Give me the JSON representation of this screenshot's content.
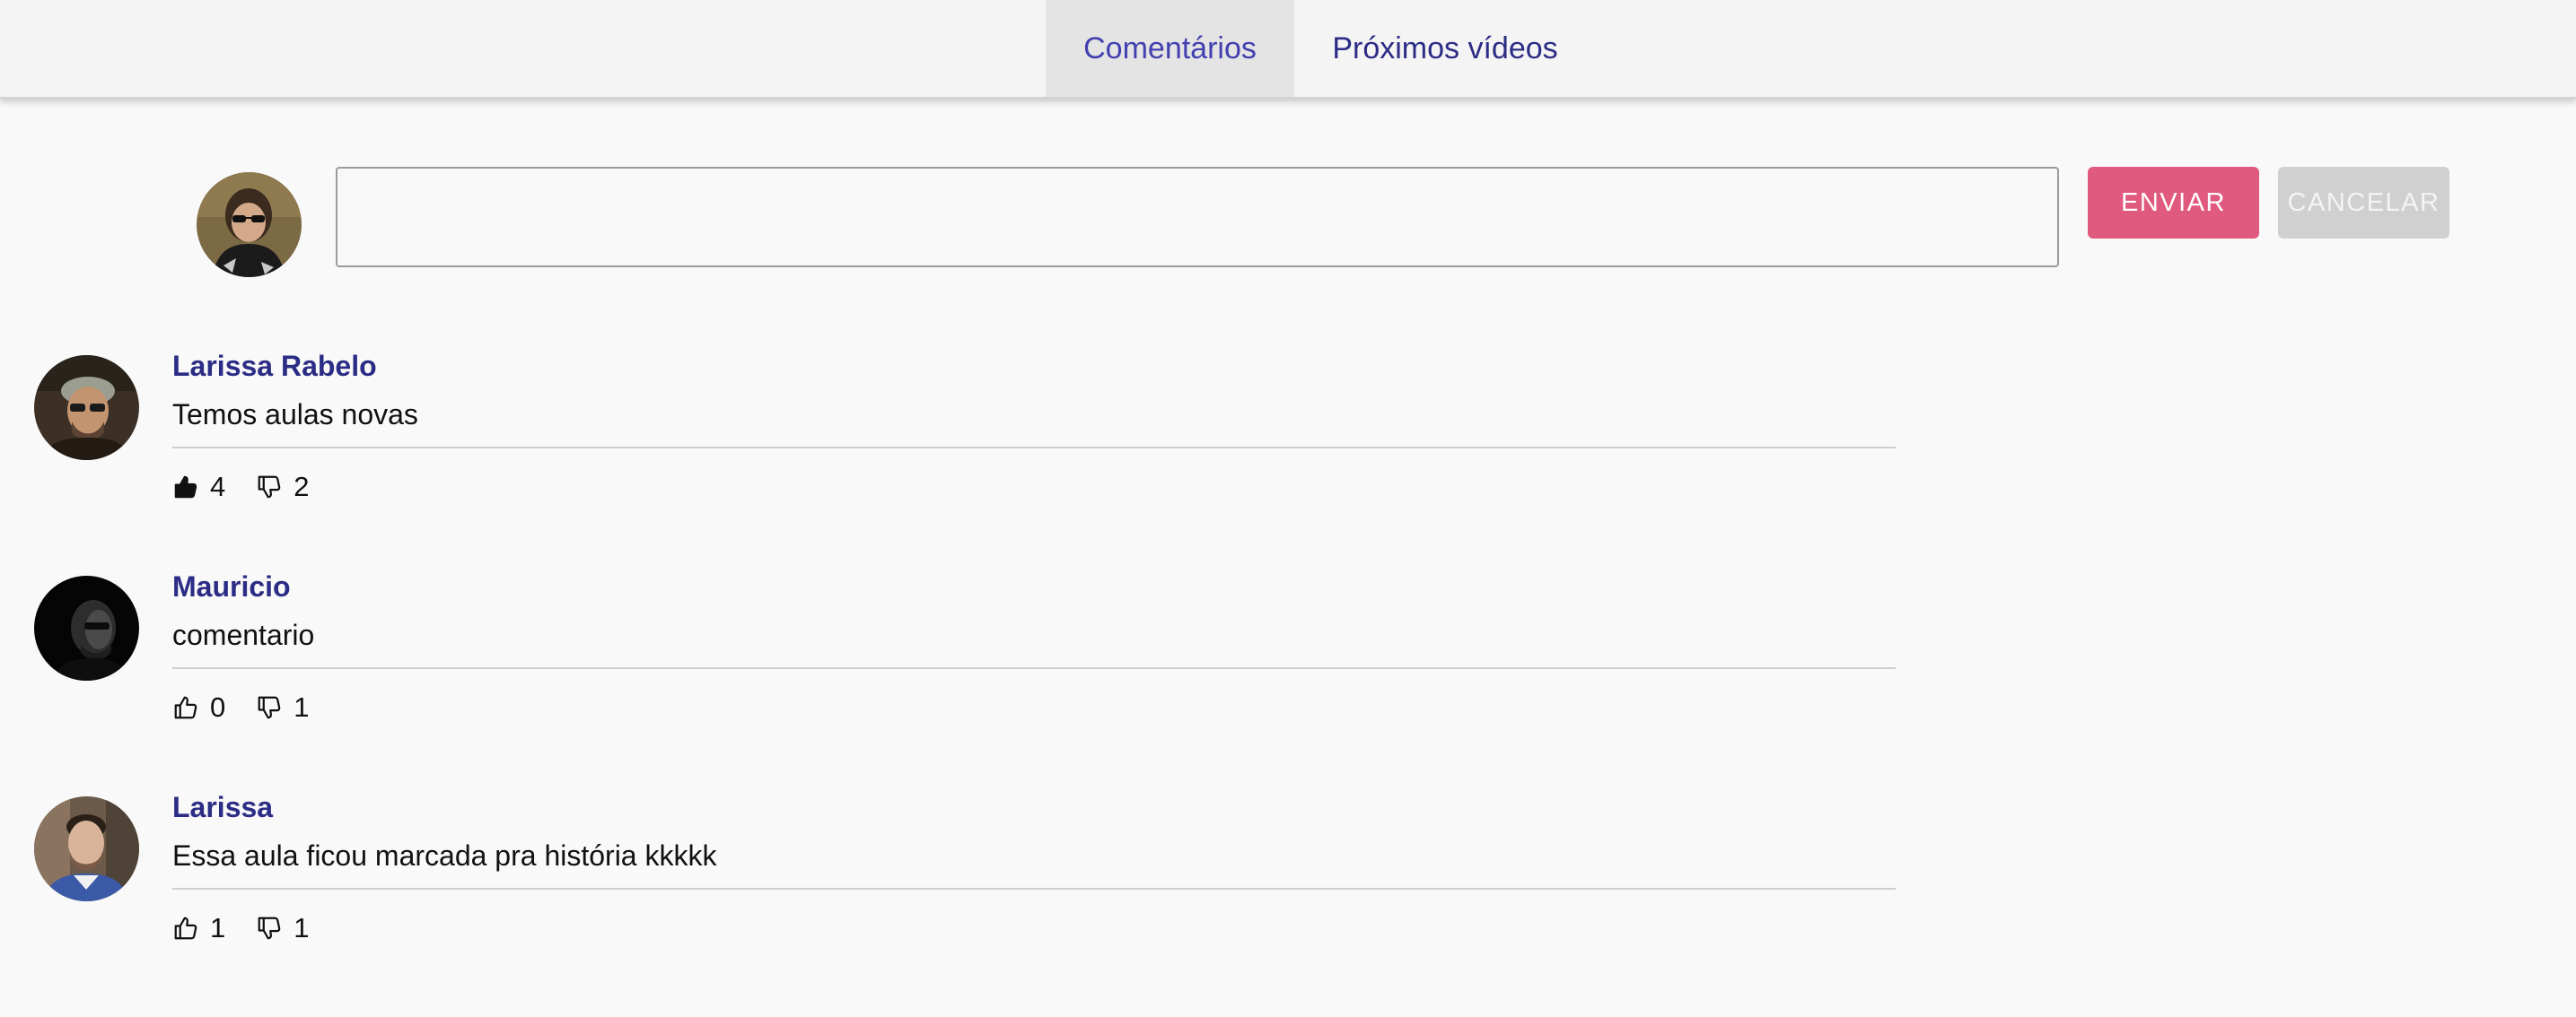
{
  "tabs": [
    {
      "label": "Comentários",
      "active": true
    },
    {
      "label": "Próximos vídeos",
      "active": false
    }
  ],
  "composer": {
    "value": "",
    "send_label": "ENVIAR",
    "cancel_label": "CANCELAR"
  },
  "comments": [
    {
      "author": "Larissa Rabelo",
      "text": "Temos aulas novas",
      "likes": "4",
      "dislikes": "2",
      "liked": true
    },
    {
      "author": "Mauricio",
      "text": "comentario",
      "likes": "0",
      "dislikes": "1",
      "liked": false
    },
    {
      "author": "Larissa",
      "text": "Essa aula ficou marcada pra história kkkkk",
      "likes": "1",
      "dislikes": "1",
      "liked": false
    }
  ],
  "colors": {
    "accent_text": "#2b2c85",
    "active_tab_text": "#4240b0",
    "send_button": "#e05a7f",
    "cancel_button": "#d0d0d0"
  },
  "icons": {
    "like": "thumbs-up-icon",
    "dislike": "thumbs-down-icon"
  }
}
